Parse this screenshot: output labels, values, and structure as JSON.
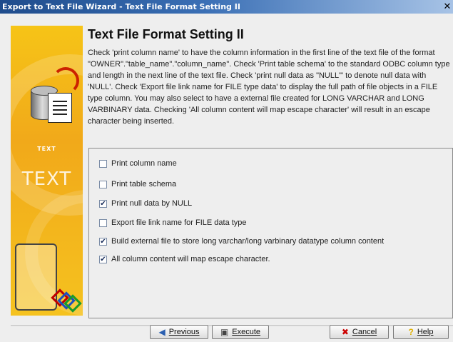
{
  "window": {
    "title": "Export to Text File Wizard - Text File Format Setting II",
    "close_glyph": "✕"
  },
  "sidebar": {
    "small_text": "TEXT",
    "big_text": "TEXT"
  },
  "content": {
    "heading": "Text File Format Setting II",
    "description": "Check 'print column name' to have the column information in the first line of the text file of the format \"OWNER\".\"table_name\".\"column_name\".  Check 'Print table schema' to the standard ODBC column type and length in the next line of the text file. Check 'print null data as \"NULL\"' to denote null data with 'NULL'. Check 'Export file link name for FILE type data' to display the full path of file objects in a FILE type column. You may also select to have a external file created for LONG VARCHAR and LONG VARBINARY data. Checking 'All column content will map escape character' will result in an escape character being inserted."
  },
  "options": [
    {
      "label": "Print column name",
      "checked": false
    },
    {
      "label": "Print table schema",
      "checked": false
    },
    {
      "label": "Print null data by NULL",
      "checked": true
    },
    {
      "label": "Export file link name for FILE data type",
      "checked": false
    },
    {
      "label": "Build external file to store long varchar/long varbinary datatype column content",
      "checked": true
    },
    {
      "label": "All column content will map escape character.",
      "checked": true
    }
  ],
  "buttons": {
    "previous": {
      "label": "Previous",
      "icon": "left-arrow-icon"
    },
    "execute": {
      "label": "Execute",
      "icon": "execute-icon"
    },
    "cancel": {
      "label": "Cancel",
      "icon": "cancel-x-icon"
    },
    "help": {
      "label": "Help",
      "icon": "help-question-icon"
    }
  },
  "colors": {
    "titlebar": "#1f4c8c",
    "sidebar": "#f1a91a",
    "cancel_icon": "#cc0000",
    "help_icon": "#e0b000",
    "previous_icon": "#2a5fb0"
  }
}
